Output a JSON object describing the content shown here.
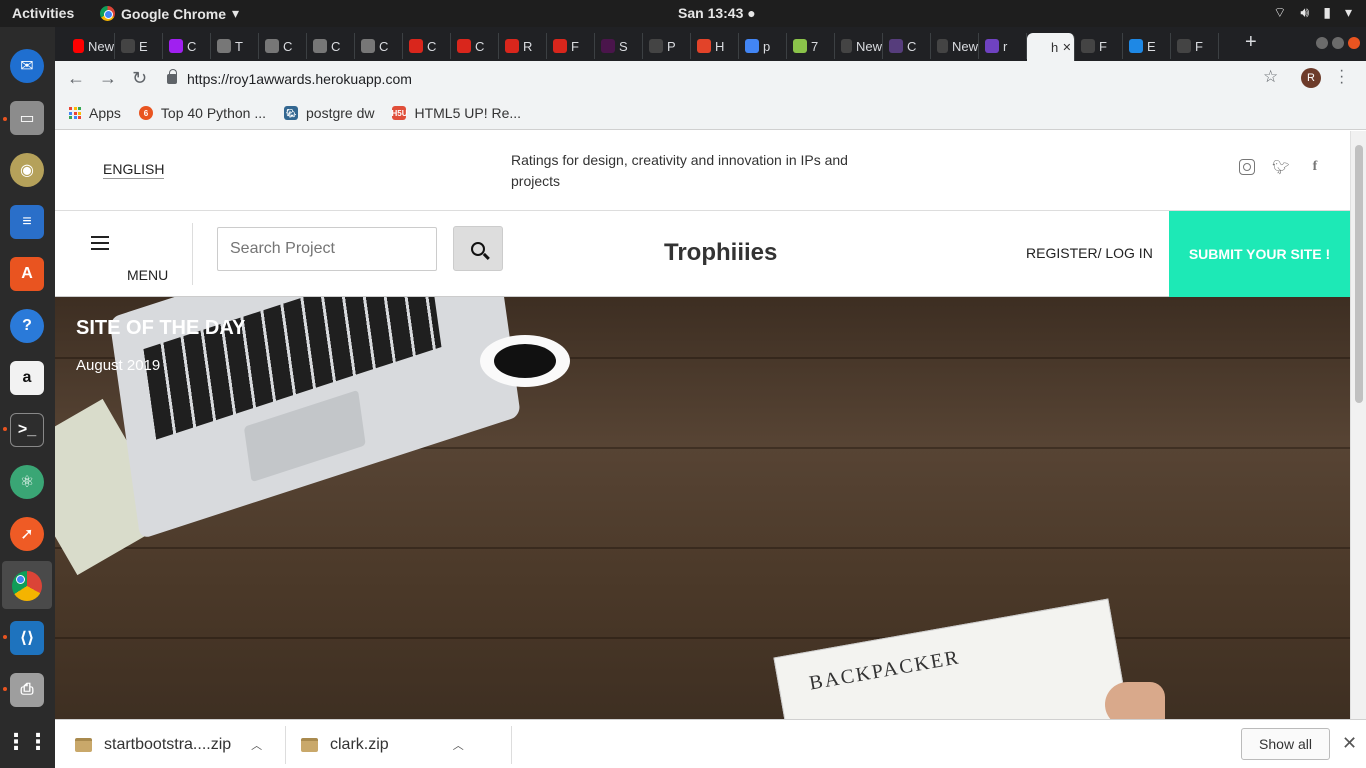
{
  "system_bar": {
    "activities": "Activities",
    "app_name": "Google Chrome",
    "clock": "San 13:43"
  },
  "browser": {
    "tabs": [
      {
        "label": "New",
        "color": "#ff0000"
      },
      {
        "label": "E",
        "color": "#444444"
      },
      {
        "label": "C",
        "color": "#a020f0"
      },
      {
        "label": "T",
        "color": "#777777"
      },
      {
        "label": "C",
        "color": "#777777"
      },
      {
        "label": "C",
        "color": "#777777"
      },
      {
        "label": "C",
        "color": "#777777"
      },
      {
        "label": "C",
        "color": "#d9261c"
      },
      {
        "label": "C",
        "color": "#d9261c"
      },
      {
        "label": "R",
        "color": "#d9261c"
      },
      {
        "label": "F",
        "color": "#d9261c"
      },
      {
        "label": "S",
        "color": "#4a154b"
      },
      {
        "label": "P",
        "color": "#444444"
      },
      {
        "label": "H",
        "color": "#e24329"
      },
      {
        "label": "p",
        "color": "#4285f4"
      },
      {
        "label": "7",
        "color": "#8bc34a"
      },
      {
        "label": "New",
        "color": "#444444"
      },
      {
        "label": "C",
        "color": "#563d7c"
      },
      {
        "label": "New",
        "color": "#444444"
      },
      {
        "label": "r",
        "color": "#6f42c1"
      },
      {
        "label": "h",
        "color": "#ffffff",
        "current": true
      },
      {
        "label": "F",
        "color": "#444444"
      },
      {
        "label": "E",
        "color": "#1e88e5"
      },
      {
        "label": "F",
        "color": "#444444"
      }
    ],
    "url": "https://roy1awwards.herokuapp.com",
    "profile_initial": "R",
    "bookmarks": [
      {
        "label": "Apps"
      },
      {
        "label": "Top 40 Python ...",
        "color": "#e95420"
      },
      {
        "label": "postgre dw",
        "color": "#336791"
      },
      {
        "label": "HTML5 UP! Re...",
        "color": "#e04e39"
      }
    ]
  },
  "site": {
    "language": "ENGLISH",
    "tagline": "Ratings for design, creativity and innovation in IPs and projects",
    "menu_label": "MENU",
    "search_placeholder": "Search Project",
    "brand": "Trophiiies",
    "register_login": "REGISTER/ LOG IN",
    "submit_site": "SUBMIT YOUR SITE !",
    "accent_color": "#1de9b6",
    "hero": {
      "title": "SITE OF THE DAY",
      "date": "August 2019",
      "newspaper_headline": "BACKPACKER"
    }
  },
  "downloads": {
    "items": [
      {
        "name": "startbootstra....zip"
      },
      {
        "name": "clark.zip"
      }
    ],
    "show_all": "Show all"
  }
}
